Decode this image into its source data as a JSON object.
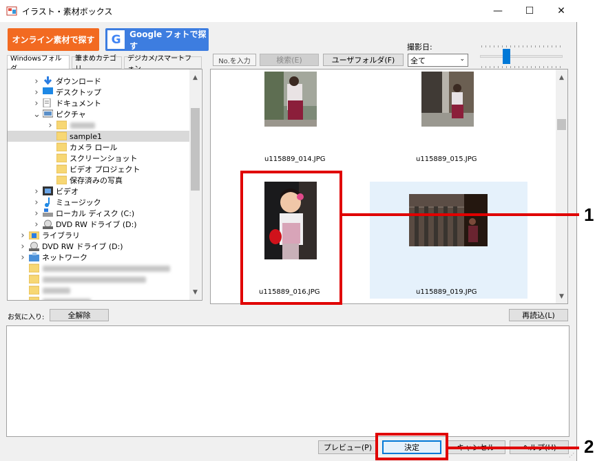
{
  "window": {
    "title": "イラスト・素材ボックス",
    "minimize_glyph": "—",
    "maximize_glyph": "☐",
    "close_glyph": "✕"
  },
  "toolbar": {
    "online_button": "オンライン素材で探す",
    "google_button": "Google フォトで探す",
    "google_logo": "G",
    "number_placeholder": "No.を入力",
    "search_button": "検索(E)",
    "user_folder_button": "ユーザフォルダ(F)",
    "date_label": "撮影日:",
    "date_selected": "全て",
    "thumbnail_size_level": 0.3
  },
  "tabs": [
    "Windowsフォルダ",
    "筆まめカテゴリ",
    "デジカメ/スマートフォン"
  ],
  "tree": [
    {
      "label": "ダウンロード",
      "icon": "download-icon",
      "level": 1,
      "chevron": ">"
    },
    {
      "label": "デスクトップ",
      "icon": "desktop-icon",
      "level": 1,
      "chevron": ">"
    },
    {
      "label": "ドキュメント",
      "icon": "document-icon",
      "level": 1,
      "chevron": ">"
    },
    {
      "label": "ピクチャ",
      "icon": "pictures-icon",
      "level": 1,
      "chevron": "v"
    },
    {
      "label": "",
      "icon": "folder-icon",
      "level": 2,
      "chevron": ">",
      "blurred": true
    },
    {
      "label": "sample1",
      "icon": "folder-icon",
      "level": 2,
      "chevron": "",
      "selected": true
    },
    {
      "label": "カメラ ロール",
      "icon": "folder-icon",
      "level": 2,
      "chevron": ""
    },
    {
      "label": "スクリーンショット",
      "icon": "folder-icon",
      "level": 2,
      "chevron": ""
    },
    {
      "label": "ビデオ プロジェクト",
      "icon": "folder-icon",
      "level": 2,
      "chevron": ""
    },
    {
      "label": "保存済みの写真",
      "icon": "folder-icon",
      "level": 2,
      "chevron": ""
    },
    {
      "label": "ビデオ",
      "icon": "video-icon",
      "level": 1,
      "chevron": ">"
    },
    {
      "label": "ミュージック",
      "icon": "music-icon",
      "level": 1,
      "chevron": ">"
    },
    {
      "label": "ローカル ディスク (C:)",
      "icon": "disk-icon",
      "level": 1,
      "chevron": ">"
    },
    {
      "label": "DVD RW ドライブ (D:)",
      "icon": "dvd-icon",
      "level": 1,
      "chevron": ">"
    },
    {
      "label": "ライブラリ",
      "icon": "library-icon",
      "level": 0,
      "chevron": ">"
    },
    {
      "label": "DVD RW ドライブ (D:)",
      "icon": "dvd-icon",
      "level": 0,
      "chevron": ">"
    },
    {
      "label": "ネットワーク",
      "icon": "network-icon",
      "level": 0,
      "chevron": ">"
    },
    {
      "label": "",
      "icon": "folder-icon",
      "level": 0,
      "chevron": "",
      "blurred": true
    },
    {
      "label": "",
      "icon": "folder-icon",
      "level": 0,
      "chevron": "",
      "blurred": true
    },
    {
      "label": "",
      "icon": "folder-icon",
      "level": 0,
      "chevron": "",
      "blurred": true
    },
    {
      "label": "",
      "icon": "folder-icon",
      "level": 0,
      "chevron": "",
      "blurred": true
    }
  ],
  "images": [
    {
      "filename": "u115889_014.JPG"
    },
    {
      "filename": "u115889_015.JPG"
    },
    {
      "filename": "u115889_016.JPG"
    },
    {
      "filename": "u115889_019.JPG"
    }
  ],
  "favorites": {
    "label": "お気に入り:",
    "clear_all": "全解除",
    "reload": "再読込(L)"
  },
  "footer": {
    "preview": "プレビュー(P)",
    "ok": "決定",
    "cancel": "キャンセル",
    "help": "ヘルプ(H)"
  },
  "callouts": {
    "one": "1",
    "two": "2"
  },
  "colors": {
    "highlight": "#e00000",
    "orange": "#f26a21",
    "google_blue": "#3d7de0",
    "selected_tile": "#e5f1fb"
  }
}
